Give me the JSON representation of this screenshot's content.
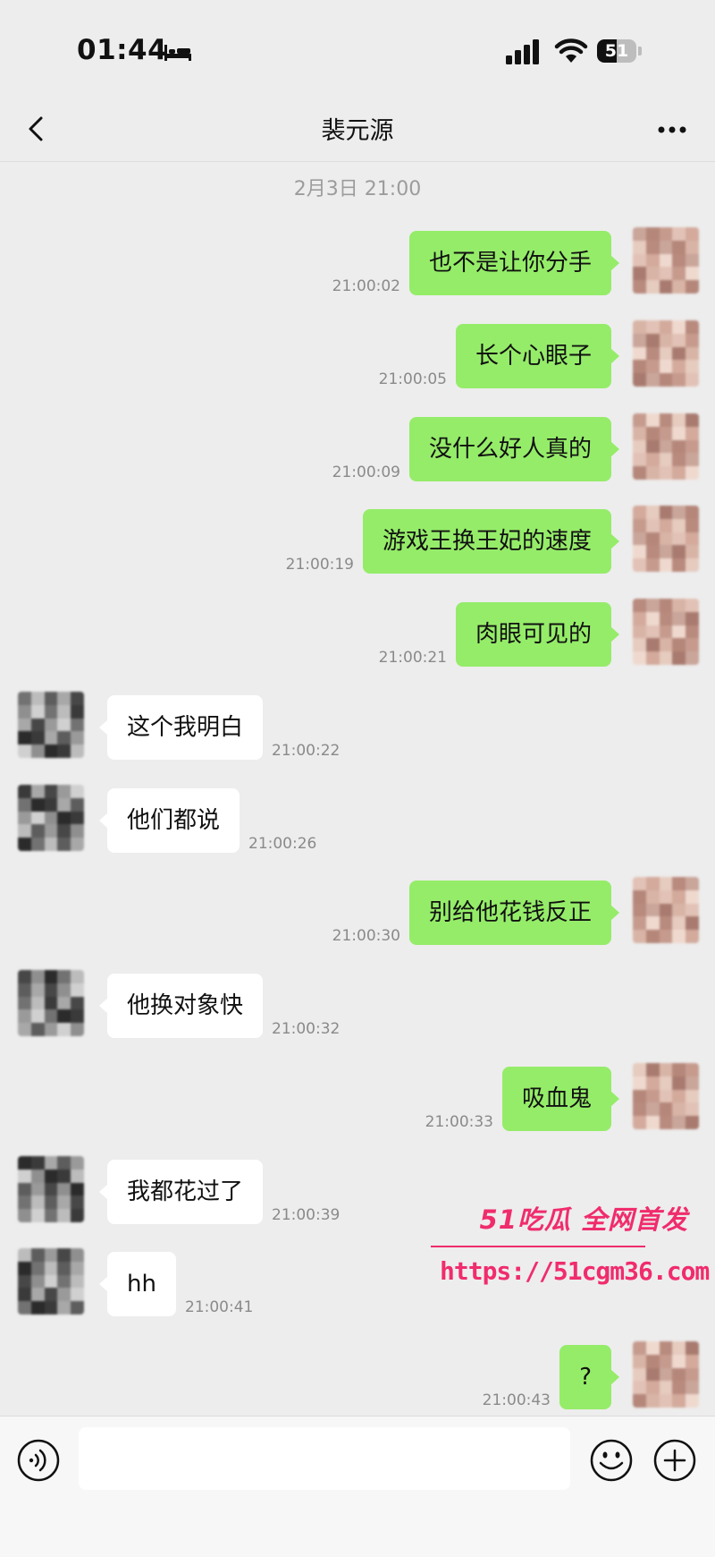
{
  "status_bar": {
    "time": "01:44",
    "battery": "51"
  },
  "nav": {
    "title": "裴元源"
  },
  "chat_date": "2月3日 21:00",
  "messages": [
    {
      "sender": "me",
      "text": "也不是让你分手",
      "time": "21:00:02"
    },
    {
      "sender": "me",
      "text": "长个心眼子",
      "time": "21:00:05"
    },
    {
      "sender": "me",
      "text": "没什么好人真的",
      "time": "21:00:09"
    },
    {
      "sender": "me",
      "text": "游戏王换王妃的速度",
      "time": "21:00:19"
    },
    {
      "sender": "me",
      "text": "肉眼可见的",
      "time": "21:00:21"
    },
    {
      "sender": "them",
      "text": "这个我明白",
      "time": "21:00:22"
    },
    {
      "sender": "them",
      "text": "他们都说",
      "time": "21:00:26"
    },
    {
      "sender": "me",
      "text": "别给他花钱反正",
      "time": "21:00:30"
    },
    {
      "sender": "them",
      "text": "他换对象快",
      "time": "21:00:32"
    },
    {
      "sender": "me",
      "text": "吸血鬼",
      "time": "21:00:33"
    },
    {
      "sender": "them",
      "text": "我都花过了",
      "time": "21:00:39"
    },
    {
      "sender": "them",
      "text": "hh",
      "time": "21:00:41"
    },
    {
      "sender": "me",
      "text": "?",
      "time": "21:00:43"
    }
  ],
  "watermark": {
    "title": "51吃瓜 全网首发",
    "url": "https://51cgm36.com"
  },
  "input_bar": {
    "value": ""
  },
  "icons": {
    "back": "chevron-left-icon",
    "more": "more-dots-icon",
    "voice": "voice-icon",
    "emoji": "emoji-icon",
    "plus": "plus-icon",
    "sleep": "bed-icon",
    "signal": "signal-icon",
    "wifi": "wifi-icon"
  },
  "colors": {
    "my_bubble": "#95ec69",
    "their_bubble": "#ffffff",
    "background": "#ededed",
    "watermark": "#f02c6c"
  }
}
